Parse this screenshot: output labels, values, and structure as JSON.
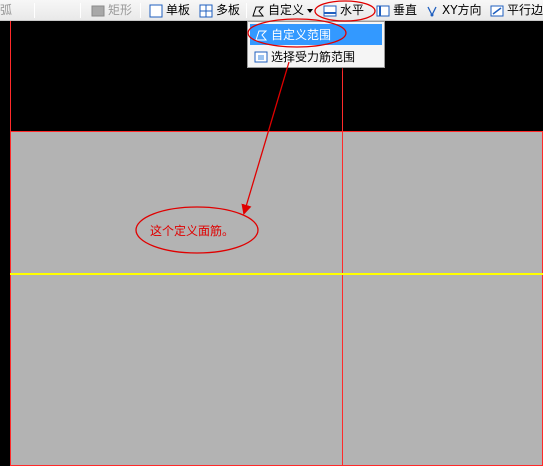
{
  "toolbar": {
    "arc_label": "弧",
    "rect_label": "矩形",
    "single_label": "单板",
    "multi_label": "多板",
    "custom_label": "自定义",
    "horizontal_label": "水平",
    "vertical_label": "垂直",
    "xy_label": "XY方向",
    "parallel_label": "平行边"
  },
  "dropdown": {
    "items": [
      {
        "label": "自定义范围",
        "icon": "custom-range-icon"
      },
      {
        "label": "选择受力筋范围",
        "icon": "select-rebar-range-icon"
      }
    ]
  },
  "annotation": {
    "text": "这个定义面筋。"
  },
  "colors": {
    "canvas": "#000000",
    "slab": "#b3b3b3",
    "grid_line": "#ff2a2a",
    "axis_line": "#ffff00",
    "annotation": "#e00000",
    "highlight": "#3399ff"
  }
}
